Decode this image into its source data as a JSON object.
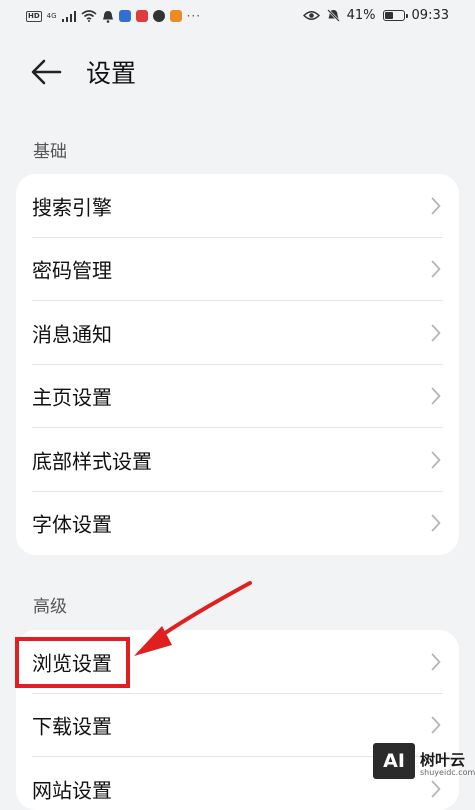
{
  "status_bar": {
    "hd": "HD",
    "signal": "4G",
    "battery": "41%",
    "battery_level": 0.41,
    "time": "09:33",
    "more": "···"
  },
  "header": {
    "title": "设置"
  },
  "sections": {
    "basic": {
      "label": "基础",
      "items": [
        {
          "label": "搜索引擎"
        },
        {
          "label": "密码管理"
        },
        {
          "label": "消息通知"
        },
        {
          "label": "主页设置"
        },
        {
          "label": "底部样式设置"
        },
        {
          "label": "字体设置"
        }
      ]
    },
    "advanced": {
      "label": "高级",
      "items": [
        {
          "label": "浏览设置"
        },
        {
          "label": "下载设置"
        },
        {
          "label": "网站设置"
        }
      ]
    }
  },
  "annotation": {
    "color": "#e02020"
  },
  "watermark": {
    "logo": "AI",
    "name": "树叶云",
    "sub": "shuyeidc.com"
  }
}
